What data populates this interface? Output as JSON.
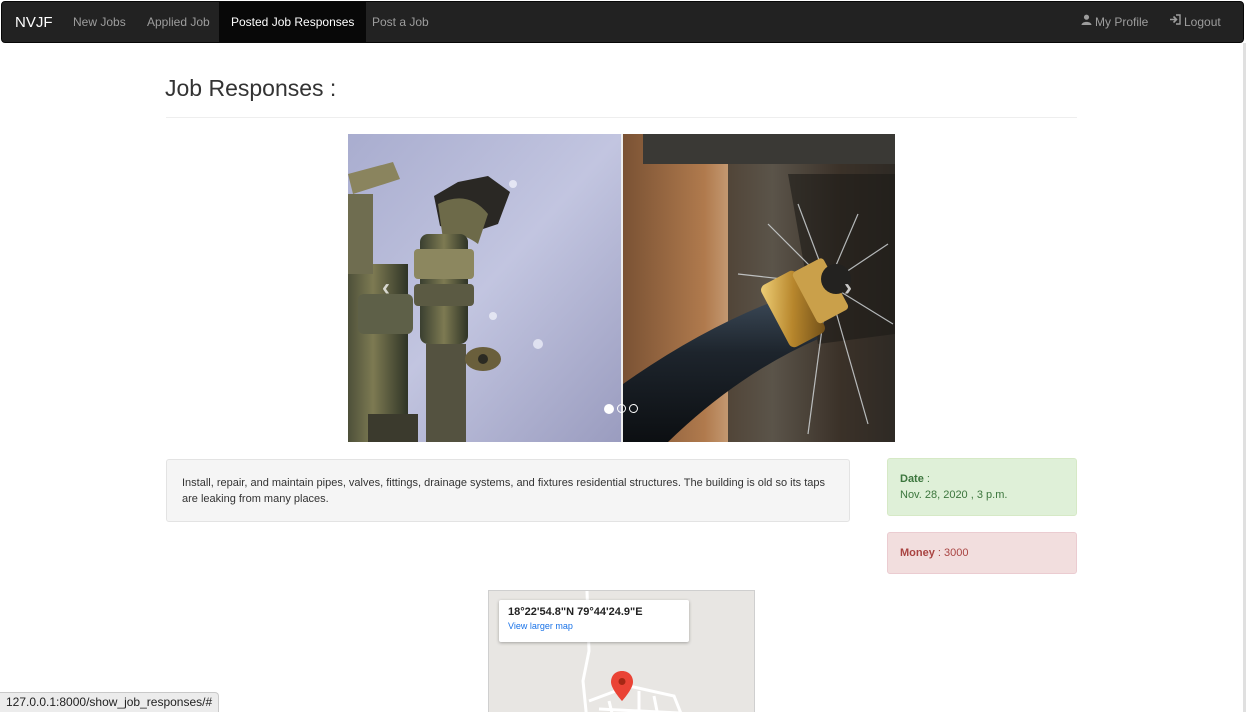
{
  "navbar": {
    "brand": "NVJF",
    "links": [
      "New Jobs",
      "Applied Job",
      "Posted Job Responses",
      "Post a Job"
    ],
    "active_index": 2,
    "profile": "My Profile",
    "logout": "Logout",
    "profile_icon": "user-icon",
    "logout_icon": "logout-icon"
  },
  "page": {
    "title": "Job Responses :"
  },
  "carousel": {
    "prev_icon": "chevron-left-icon",
    "next_icon": "chevron-right-icon",
    "prev_glyph": "‹",
    "next_glyph": "›",
    "slide_count": 3,
    "active_slide": 1
  },
  "job": {
    "description": "Install, repair, and maintain pipes, valves, fittings, drainage systems, and fixtures residential structures. The building is old so its taps are leaking from many places.",
    "date_label": "Date",
    "date_value": "Nov. 28, 2020 , 3 p.m.",
    "money_label": "Money",
    "money_value": "3000"
  },
  "map": {
    "coords": "18°22'54.8\"N 79°44'24.9\"E",
    "link": "View larger map",
    "pin_icon": "map-pin-icon"
  },
  "status_bar": {
    "url": "127.0.0.1:8000/show_job_responses/#"
  },
  "colors": {
    "navbar_bg": "#222222",
    "success_bg": "#dff0d8",
    "danger_bg": "#f2dede"
  }
}
